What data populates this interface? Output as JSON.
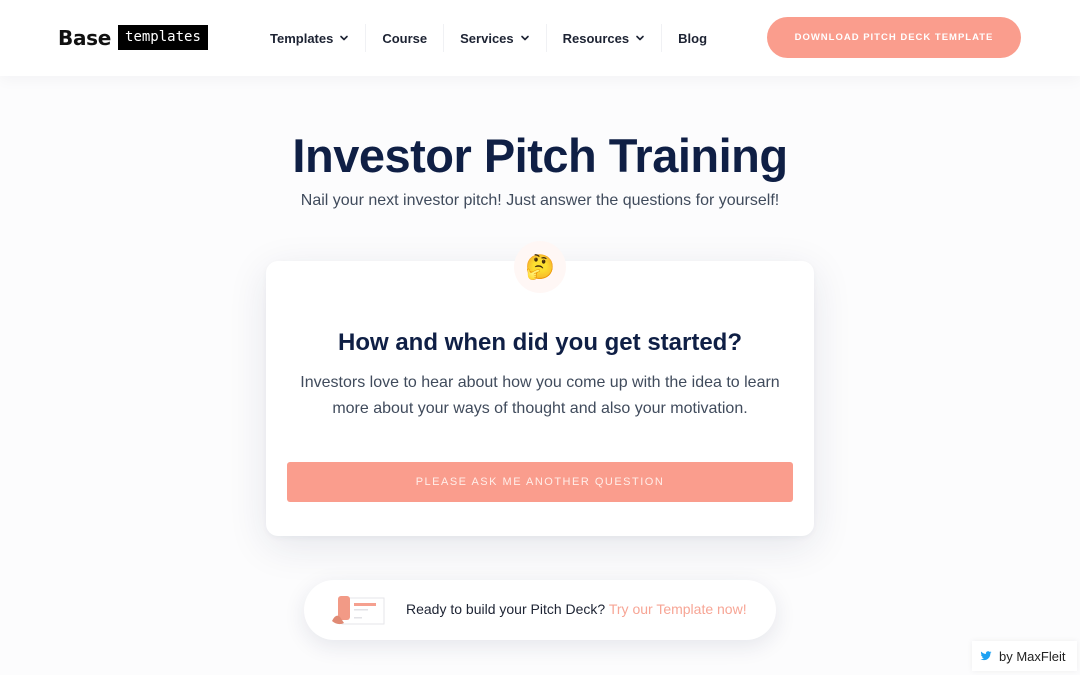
{
  "header": {
    "logo": {
      "base": "Base",
      "templates": "templates"
    },
    "nav": [
      {
        "label": "Templates",
        "has_dropdown": true,
        "icon": "chevron-down-icon"
      },
      {
        "label": "Course",
        "has_dropdown": false
      },
      {
        "label": "Services",
        "has_dropdown": true,
        "icon": "chevron-down-icon"
      },
      {
        "label": "Resources",
        "has_dropdown": true,
        "icon": "chevron-down-icon"
      },
      {
        "label": "Blog",
        "has_dropdown": false
      }
    ],
    "cta_label": "DOWNLOAD PITCH DECK TEMPLATE"
  },
  "hero": {
    "title": "Investor Pitch Training",
    "subtitle": "Nail your next investor pitch! Just answer the questions for yourself!"
  },
  "card": {
    "emoji": "🤔",
    "emoji_icon": "thinking-face-icon",
    "question": "How and when did you get started?",
    "body": "Investors love to hear about how you come up with the idea to learn more about your ways of thought and also your motivation.",
    "button_label": "PLEASE ASK ME ANOTHER QUESTION"
  },
  "promo": {
    "thumb_icon": "pitch-deck-thumbnail-icon",
    "text": "Ready to build your Pitch Deck? ",
    "link_text": "Try our Template now!"
  },
  "byline": {
    "icon": "twitter-icon",
    "text": "by MaxFleit"
  },
  "colors": {
    "accent": "#fa9d8d",
    "heading": "#0f1f45",
    "body_text": "#404b5c",
    "link": "#f7a595",
    "twitter": "#1da1f2"
  }
}
